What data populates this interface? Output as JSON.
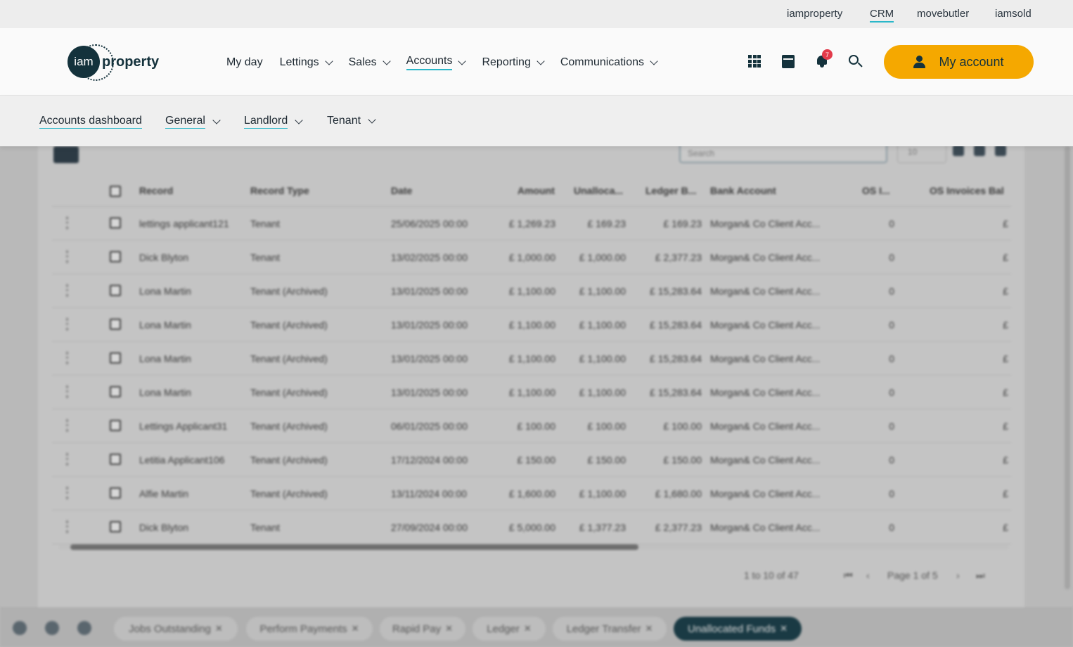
{
  "brand_links": [
    {
      "label": "iamproperty",
      "active": false
    },
    {
      "label": "CRM",
      "active": true
    },
    {
      "label": "movebutler",
      "active": false
    },
    {
      "label": "iamsold",
      "active": false
    }
  ],
  "logo": {
    "mark": "iam",
    "word": "property"
  },
  "main_nav": [
    {
      "label": "My day",
      "dropdown": false,
      "active": false
    },
    {
      "label": "Lettings",
      "dropdown": true,
      "active": false
    },
    {
      "label": "Sales",
      "dropdown": true,
      "active": false
    },
    {
      "label": "Accounts",
      "dropdown": true,
      "active": true
    },
    {
      "label": "Reporting",
      "dropdown": true,
      "active": false
    },
    {
      "label": "Communications",
      "dropdown": true,
      "active": false
    }
  ],
  "header_icons": {
    "apps": "grid-icon",
    "calendar": "calendar-icon",
    "notifications": "bell-icon",
    "notification_count": "7",
    "search": "search-icon"
  },
  "account_button": {
    "label": "My account",
    "icon": "user-icon",
    "color": "#f5a800"
  },
  "sub_nav": [
    {
      "label": "Accounts dashboard",
      "dropdown": false
    },
    {
      "label": "General",
      "dropdown": true
    },
    {
      "label": "Landlord",
      "dropdown": true
    },
    {
      "label": "Tenant",
      "dropdown": true
    }
  ],
  "table": {
    "search_placeholder": "Search",
    "page_size": "10",
    "columns": [
      "Record",
      "Record Type",
      "Date",
      "Amount",
      "Unalloca...",
      "Ledger B...",
      "Bank Account",
      "OS I...",
      "OS Invoices Bal"
    ],
    "rows": [
      [
        "lettings applicant121",
        "Tenant",
        "25/06/2025 00:00",
        "£ 1,269.23",
        "£ 169.23",
        "£ 169.23",
        "Morgan& Co Client Acc...",
        "0",
        "£"
      ],
      [
        "Dick Blyton",
        "Tenant",
        "13/02/2025 00:00",
        "£ 1,000.00",
        "£ 1,000.00",
        "£ 2,377.23",
        "Morgan& Co Client Acc...",
        "0",
        "£"
      ],
      [
        "Lona Martin",
        "Tenant (Archived)",
        "13/01/2025 00:00",
        "£ 1,100.00",
        "£ 1,100.00",
        "£ 15,283.64",
        "Morgan& Co Client Acc...",
        "0",
        "£"
      ],
      [
        "Lona Martin",
        "Tenant (Archived)",
        "13/01/2025 00:00",
        "£ 1,100.00",
        "£ 1,100.00",
        "£ 15,283.64",
        "Morgan& Co Client Acc...",
        "0",
        "£"
      ],
      [
        "Lona Martin",
        "Tenant (Archived)",
        "13/01/2025 00:00",
        "£ 1,100.00",
        "£ 1,100.00",
        "£ 15,283.64",
        "Morgan& Co Client Acc...",
        "0",
        "£"
      ],
      [
        "Lona Martin",
        "Tenant (Archived)",
        "13/01/2025 00:00",
        "£ 1,100.00",
        "£ 1,100.00",
        "£ 15,283.64",
        "Morgan& Co Client Acc...",
        "0",
        "£"
      ],
      [
        "Lettings Applicant31",
        "Tenant (Archived)",
        "06/01/2025 00:00",
        "£ 100.00",
        "£ 100.00",
        "£ 100.00",
        "Morgan& Co Client Acc...",
        "0",
        "£"
      ],
      [
        "Letitia Applicant106",
        "Tenant (Archived)",
        "17/12/2024 00:00",
        "£ 150.00",
        "£ 150.00",
        "£ 150.00",
        "Morgan& Co Client Acc...",
        "0",
        "£"
      ],
      [
        "Alfie Martin",
        "Tenant (Archived)",
        "13/11/2024 00:00",
        "£ 1,600.00",
        "£ 1,100.00",
        "£ 1,680.00",
        "Morgan& Co Client Acc...",
        "0",
        "£"
      ],
      [
        "Dick Blyton",
        "Tenant",
        "27/09/2024 00:00",
        "£ 5,000.00",
        "£ 1,377.23",
        "£ 2,377.23",
        "Morgan& Co Client Acc...",
        "0",
        "£"
      ]
    ],
    "range_text": "1 to 10 of 47",
    "page_text": "Page 1 of 5"
  },
  "bottom_tabs": [
    {
      "label": "Jobs Outstanding",
      "active": false
    },
    {
      "label": "Perform Payments",
      "active": false
    },
    {
      "label": "Rapid Pay",
      "active": false
    },
    {
      "label": "Ledger",
      "active": false
    },
    {
      "label": "Ledger Transfer",
      "active": false
    },
    {
      "label": "Unallocated Funds",
      "active": true
    }
  ]
}
